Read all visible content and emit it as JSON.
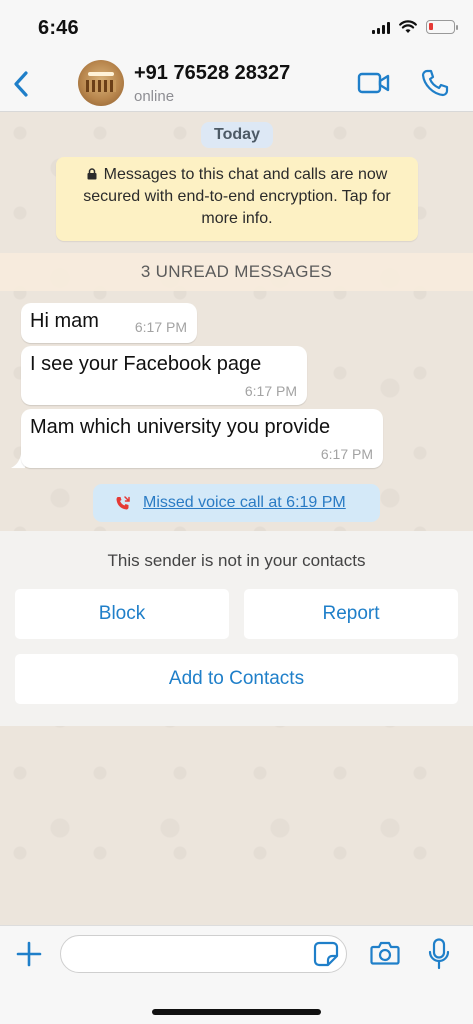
{
  "status_bar": {
    "time": "6:46"
  },
  "header": {
    "contact_name": "+91 76528 28327",
    "contact_status": "online"
  },
  "chat": {
    "date_label": "Today",
    "encryption_notice": "Messages to this chat and calls are now secured with end-to-end encryption. Tap for more info.",
    "unread_label": "3 UNREAD MESSAGES",
    "messages": [
      {
        "text": "Hi mam",
        "time": "6:17 PM"
      },
      {
        "text": "I see your Facebook page",
        "time": "6:17 PM"
      },
      {
        "text": "Mam which university you provide",
        "time": "6:17 PM"
      }
    ],
    "missed_call": "Missed voice call at 6:19 PM"
  },
  "unknown_sender": {
    "notice": "This sender is not in your contacts",
    "block_label": "Block",
    "report_label": "Report",
    "add_label": "Add to Contacts"
  },
  "colors": {
    "accent": "#1f7fc9",
    "chat_bg": "#ece5dc",
    "encryption_bg": "#fdf1c4",
    "missed_call_bg": "#d4e9f8",
    "missed_icon": "#e53935"
  }
}
